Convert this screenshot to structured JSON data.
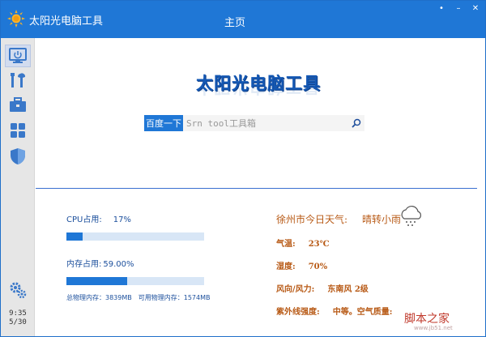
{
  "titlebar": {
    "app_name": "太阳光电脑工具",
    "page_title": "主页",
    "controls": [
      "•",
      "–",
      "✕"
    ]
  },
  "sidebar": {
    "items": [
      "home-icon",
      "tools-icon",
      "toolbox-icon",
      "apps-icon",
      "shield-icon"
    ],
    "settings_icon": "gears-icon",
    "time": "9:35",
    "date": "5/30"
  },
  "hero": {
    "title": "太阳光电脑工具",
    "search_button": "百度一下",
    "search_placeholder": "Srn tool工具箱"
  },
  "stats": {
    "cpu_label": "CPU占用:",
    "cpu_value": "17%",
    "cpu_fraction": 0.12,
    "mem_label": "内存占用:",
    "mem_value": "59.00%",
    "mem_fraction": 0.44,
    "total_mem": "总物理内存：3839MB",
    "avail_mem": "可用物理内存：1574MB"
  },
  "weather": {
    "city": "徐州市今日天气:",
    "condition": "晴转小雨",
    "temp_label": "气温:",
    "temp_value": "23℃",
    "humidity_label": "湿度:",
    "humidity_value": "70%",
    "wind_label": "风向/风力:",
    "wind_value": "东南风 2级",
    "uv_label": "紫外线强度:",
    "uv_value": "中等。空气质量:",
    "icon": "cloud-rain-icon"
  },
  "watermark": {
    "text": "脚本之家",
    "url": "www.jb51.net"
  },
  "colors": {
    "accent": "#1f77d6",
    "weather_text": "#b85a16",
    "stat_text": "#1b4f9c"
  }
}
